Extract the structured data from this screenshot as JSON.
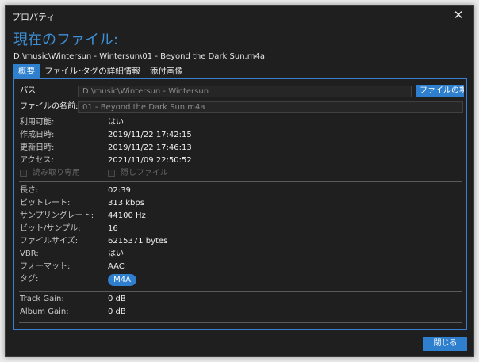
{
  "window": {
    "title": "プロパティ"
  },
  "header": {
    "heading": "現在のファイル:",
    "filepath": "D:\\music\\Wintersun - Wintersun\\01 - Beyond the Dark Sun.m4a"
  },
  "tabs": [
    {
      "label": "概要",
      "active": true
    },
    {
      "label": "ファイル･タグの詳細情報",
      "active": false
    },
    {
      "label": "添付画像",
      "active": false
    }
  ],
  "path_field": {
    "label": "パス",
    "value": "D:\\music\\Wintersun - Wintersun",
    "button": "ファイルの場所"
  },
  "name_field": {
    "label": "ファイルの名前:",
    "value": "01 - Beyond the Dark Sun.m4a"
  },
  "info": [
    {
      "label": "利用可能:",
      "value": "はい"
    },
    {
      "label": "作成日時:",
      "value": "2019/11/22 17:42:15"
    },
    {
      "label": "更新日時:",
      "value": "2019/11/22 17:46:13"
    },
    {
      "label": "アクセス:",
      "value": "2021/11/09 22:50:52"
    }
  ],
  "checkboxes": [
    {
      "label": "読み取り専用",
      "checked": false
    },
    {
      "label": "隠しファイル",
      "checked": false
    }
  ],
  "audio": [
    {
      "label": "長さ:",
      "value": "02:39"
    },
    {
      "label": "ビットレート:",
      "value": "313 kbps"
    },
    {
      "label": "サンプリングレート:",
      "value": "44100 Hz"
    },
    {
      "label": "ビット/サンプル:",
      "value": "16"
    },
    {
      "label": "ファイルサイズ:",
      "value": "6215371 bytes"
    },
    {
      "label": "VBR:",
      "value": "はい"
    },
    {
      "label": "フォーマット:",
      "value": "AAC"
    }
  ],
  "tag": {
    "label": "タグ:",
    "value": "M4A"
  },
  "gain": [
    {
      "label": "Track Gain:",
      "value": "0 dB"
    },
    {
      "label": "Album Gain:",
      "value": "0 dB"
    }
  ],
  "footer": {
    "close_label": "閉じる"
  },
  "colors": {
    "accent": "#2f7fcf",
    "heading": "#3d8fd6",
    "background": "#1f1f1f"
  }
}
